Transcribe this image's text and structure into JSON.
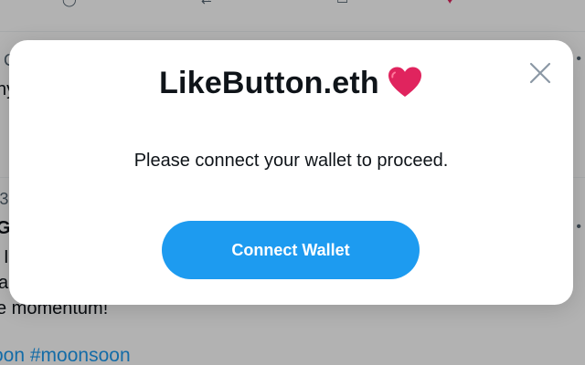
{
  "modal": {
    "title": "LikeButton.eth",
    "message": "Please connect your wallet to proceed.",
    "connect_button_label": "Connect Wallet",
    "close_icon": "close-icon",
    "title_icon": "heart-icon"
  },
  "feed": {
    "fragment_handle": "C",
    "fragment_line1": "hy",
    "fragment_date": "'3",
    "fragment_bold": "G",
    "fragment_line2": "I",
    "fragment_line3": "a",
    "fragment_text": "e momentum!",
    "hashtags": "oon #moonsoon",
    "more_icon": "more-icon"
  },
  "colors": {
    "accent": "#1d9bf0",
    "text": "#0f1419",
    "muted": "#536471",
    "heart": "#e0245e"
  }
}
